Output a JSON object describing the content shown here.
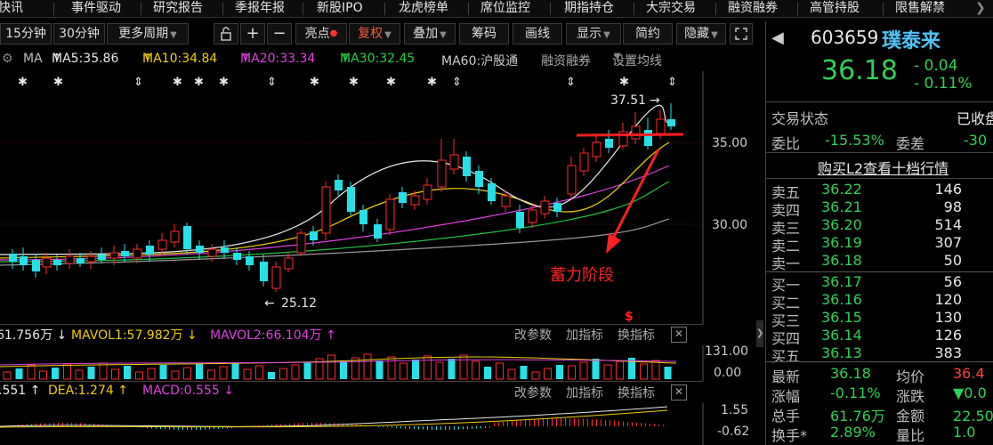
{
  "nav": {
    "items": [
      "快讯",
      "事件驱动",
      "研究报告",
      "季报年报",
      "新股IPO",
      "龙虎榜单",
      "席位监控",
      "期指持仓",
      "大宗交易",
      "融资融券",
      "高管持股",
      "限售解禁"
    ]
  },
  "toolbar": {
    "period_15": "15分钟",
    "period_30": "30分钟",
    "more_periods": "更多周期",
    "highlight": "亮点",
    "fuquan": "复权",
    "overlay": "叠加",
    "chips": "筹码",
    "draw": "画线",
    "display": "显示",
    "simple": "简约",
    "hide": "隐藏"
  },
  "ma_row": {
    "ma": "MA",
    "ma5": "MA5:35.86",
    "ma10": "MA10:34.84",
    "ma20": "MA20:33.34",
    "ma30": "MA30:32.45",
    "ma60": "MA60:沪股通",
    "margin": "融资融券",
    "settings": "设置均线"
  },
  "chart": {
    "high_label": "37.51",
    "low_label": "25.12",
    "annotation": "蓄力阶段",
    "price_ticks": [
      "35.00",
      "30.00"
    ],
    "colors": {
      "up": "#ff2a2a",
      "down": "#26e0e8",
      "ma5": "#e8e8e8",
      "ma10": "#f0d000",
      "ma20": "#e040e0",
      "ma30": "#20c040",
      "ma60": "#999999"
    }
  },
  "volume": {
    "lead": "61.756万",
    "mavol1": "MAVOL1:57.982万",
    "mavol2": "MAVOL2:66.104万",
    "adjust": "改参数",
    "add_indicator": "加指标",
    "switch_indicator": "换指标",
    "ticks": [
      "131.00",
      "0.00"
    ]
  },
  "macd": {
    "dif": ".551",
    "dea": "DEA:1.274",
    "macd": "MACD:0.555",
    "adjust": "改参数",
    "add_indicator": "加指标",
    "switch_indicator": "换指标",
    "ticks": [
      "1.55",
      "-0.62"
    ]
  },
  "quote": {
    "code": "603659",
    "name": "璞泰来",
    "price": "36.18",
    "change": "- 0.04",
    "change_pct": "- 0.11%",
    "status_label": "交易状态",
    "status_value": "已收盘",
    "weibi_label": "委比",
    "weibi_value": "-15.53%",
    "weicha_label": "委差",
    "weicha_value": "-30",
    "l2_link": "购买L2查看十档行情",
    "asks": [
      {
        "label": "卖五",
        "price": "36.22",
        "vol": "146"
      },
      {
        "label": "卖四",
        "price": "36.21",
        "vol": "98"
      },
      {
        "label": "卖三",
        "price": "36.20",
        "vol": "514"
      },
      {
        "label": "卖二",
        "price": "36.19",
        "vol": "307"
      },
      {
        "label": "卖一",
        "price": "36.18",
        "vol": "50"
      }
    ],
    "bids": [
      {
        "label": "买一",
        "price": "36.17",
        "vol": "56"
      },
      {
        "label": "买二",
        "price": "36.16",
        "vol": "120"
      },
      {
        "label": "买三",
        "price": "36.15",
        "vol": "130"
      },
      {
        "label": "买四",
        "price": "36.14",
        "vol": "126"
      },
      {
        "label": "买五",
        "price": "36.13",
        "vol": "383"
      }
    ],
    "stats": [
      {
        "l1": "最新",
        "v1": "36.18",
        "l2": "均价",
        "v2": "36.4"
      },
      {
        "l1": "涨幅",
        "v1": "-0.11%",
        "l2": "涨跌",
        "v2": "▼0.0"
      },
      {
        "l1": "总手",
        "v1": "61.76万",
        "l2": "金额",
        "v2": "22.50亿"
      },
      {
        "l1": "换手*",
        "v1": "2.89%",
        "l2": "量比",
        "v2": "1.0"
      }
    ]
  }
}
